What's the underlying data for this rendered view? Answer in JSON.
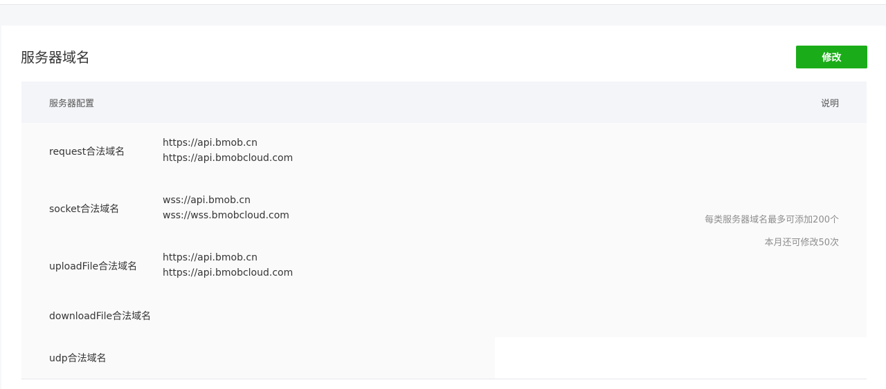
{
  "card": {
    "title": "服务器域名",
    "edit_label": "修改"
  },
  "table": {
    "header_config": "服务器配置",
    "header_desc": "说明",
    "rows": [
      {
        "label": "request合法域名",
        "values": [
          "https://api.bmob.cn",
          "https://api.bmobcloud.com"
        ]
      },
      {
        "label": "socket合法域名",
        "values": [
          "wss://api.bmob.cn",
          "wss://wss.bmobcloud.com"
        ]
      },
      {
        "label": "uploadFile合法域名",
        "values": [
          "https://api.bmob.cn",
          "https://api.bmobcloud.com"
        ]
      },
      {
        "label": "downloadFile合法域名",
        "values": []
      },
      {
        "label": "udp合法域名",
        "values": []
      }
    ],
    "notes": [
      "每类服务器域名最多可添加200个",
      "本月还可修改50次"
    ]
  }
}
